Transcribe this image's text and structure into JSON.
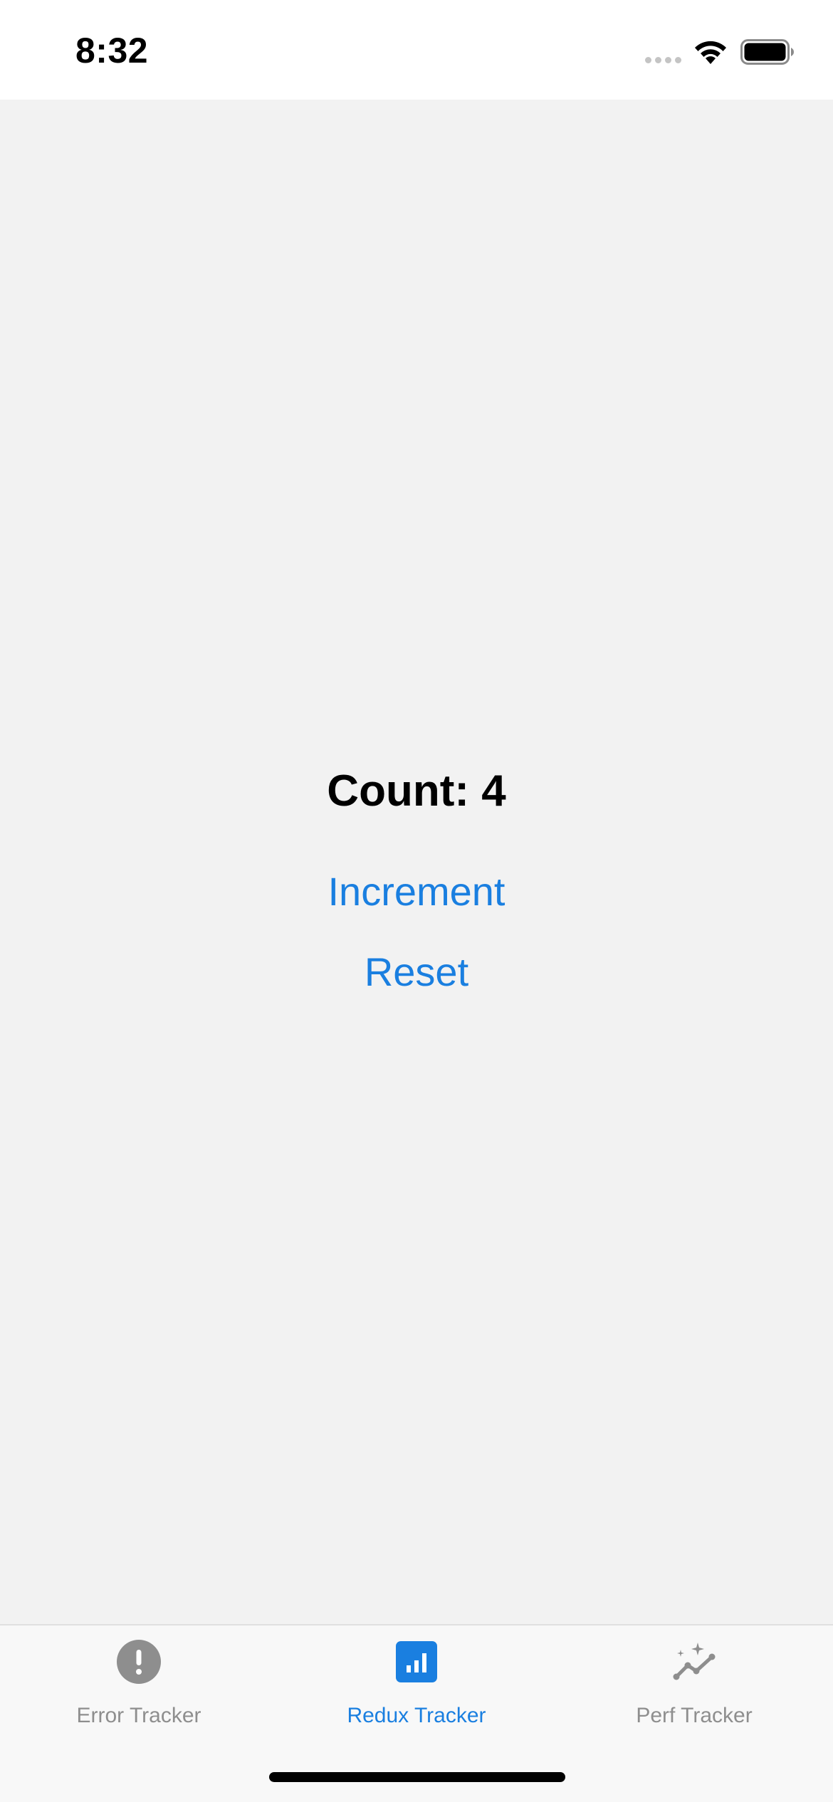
{
  "status_bar": {
    "time": "8:32",
    "signal_icon": "cellular-signal-icon",
    "wifi_icon": "wifi-icon",
    "battery_icon": "battery-icon"
  },
  "main": {
    "count_label": "Count: 4",
    "increment_label": "Increment",
    "reset_label": "Reset"
  },
  "tabs": [
    {
      "label": "Error Tracker",
      "icon": "exclamation-circle-icon",
      "active": false
    },
    {
      "label": "Redux Tracker",
      "icon": "bar-chart-icon",
      "active": true
    },
    {
      "label": "Perf Tracker",
      "icon": "sparkline-chart-icon",
      "active": false
    }
  ],
  "colors": {
    "accent": "#1a7fe0",
    "inactive": "#8e8e8e",
    "background": "#f2f2f2",
    "tab_bar_bg": "#f8f8f8"
  }
}
